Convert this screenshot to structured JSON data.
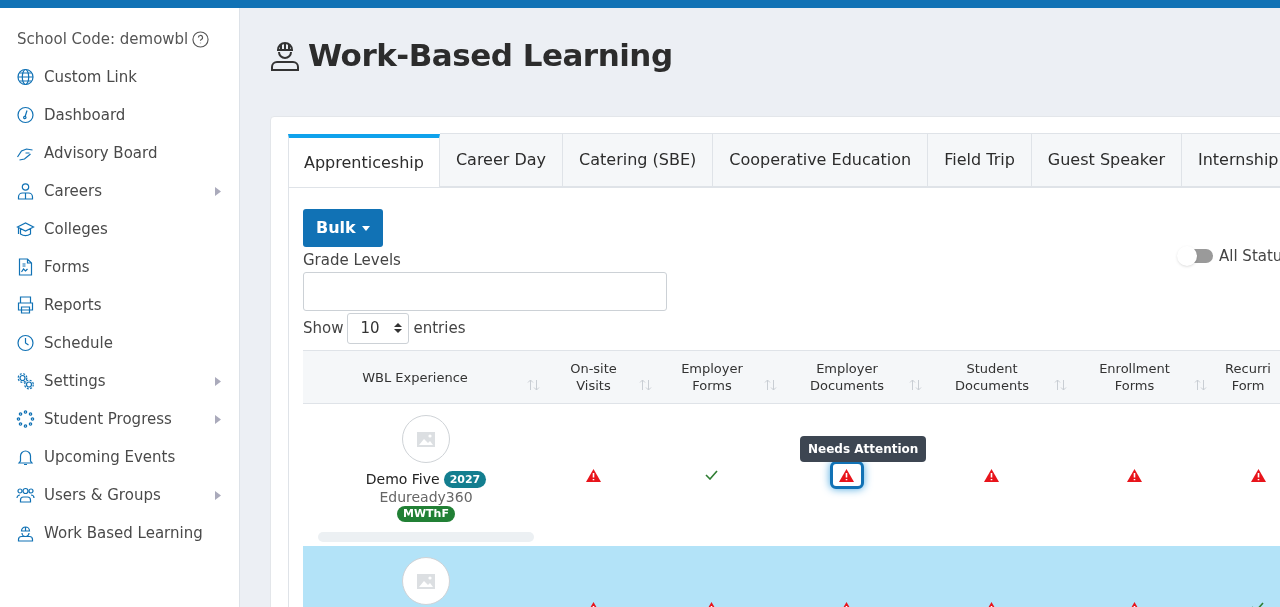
{
  "sidebar": {
    "school_code": "School Code: demowbl",
    "items": [
      {
        "label": "Custom Link",
        "has_submenu": false
      },
      {
        "label": "Dashboard",
        "has_submenu": false
      },
      {
        "label": "Advisory Board",
        "has_submenu": false
      },
      {
        "label": "Careers",
        "has_submenu": true
      },
      {
        "label": "Colleges",
        "has_submenu": false
      },
      {
        "label": "Forms",
        "has_submenu": false
      },
      {
        "label": "Reports",
        "has_submenu": false
      },
      {
        "label": "Schedule",
        "has_submenu": false
      },
      {
        "label": "Settings",
        "has_submenu": true
      },
      {
        "label": "Student Progress",
        "has_submenu": true
      },
      {
        "label": "Upcoming Events",
        "has_submenu": false
      },
      {
        "label": "Users & Groups",
        "has_submenu": true
      },
      {
        "label": "Work Based Learning",
        "has_submenu": false
      }
    ]
  },
  "page": {
    "title": "Work-Based Learning"
  },
  "tabs": [
    {
      "label": "Apprenticeship",
      "selected": true
    },
    {
      "label": "Career Day",
      "selected": false
    },
    {
      "label": "Catering (SBE)",
      "selected": false
    },
    {
      "label": "Cooperative Education",
      "selected": false
    },
    {
      "label": "Field Trip",
      "selected": false
    },
    {
      "label": "Guest Speaker",
      "selected": false
    },
    {
      "label": "Internship",
      "selected": false
    }
  ],
  "bulk_button": "Bulk",
  "grade_levels": {
    "label": "Grade Levels"
  },
  "all_status_toggle": {
    "label": "All Statu",
    "on": false
  },
  "entries": {
    "before": "Show",
    "value": "10",
    "after": "entries"
  },
  "table": {
    "columns": [
      "WBL Experience",
      "On-site Visits",
      "Employer Forms",
      "Employer Documents",
      "Student Documents",
      "Enrollment Forms",
      "Recurri Form"
    ],
    "rows": [
      {
        "selected": false,
        "cells": [
          {
            "kind": "experience",
            "name": "Demo Five",
            "year": "2027",
            "school": "Eduready360",
            "days": "MWThF"
          },
          {
            "kind": "warning",
            "focused": false
          },
          {
            "kind": "check",
            "focused": false
          },
          {
            "kind": "warning",
            "focused": true,
            "tooltip": "Needs Attention"
          },
          {
            "kind": "warning",
            "focused": false
          },
          {
            "kind": "warning",
            "focused": false
          },
          {
            "kind": "warning",
            "focused": false
          }
        ]
      },
      {
        "selected": true,
        "cells": [
          {
            "kind": "experience"
          },
          {
            "kind": "warning",
            "focused": false
          },
          {
            "kind": "warning",
            "focused": false
          },
          {
            "kind": "warning",
            "focused": false
          },
          {
            "kind": "warning",
            "focused": false
          },
          {
            "kind": "warning",
            "focused": false
          },
          {
            "kind": "check",
            "focused": false
          }
        ]
      }
    ]
  }
}
